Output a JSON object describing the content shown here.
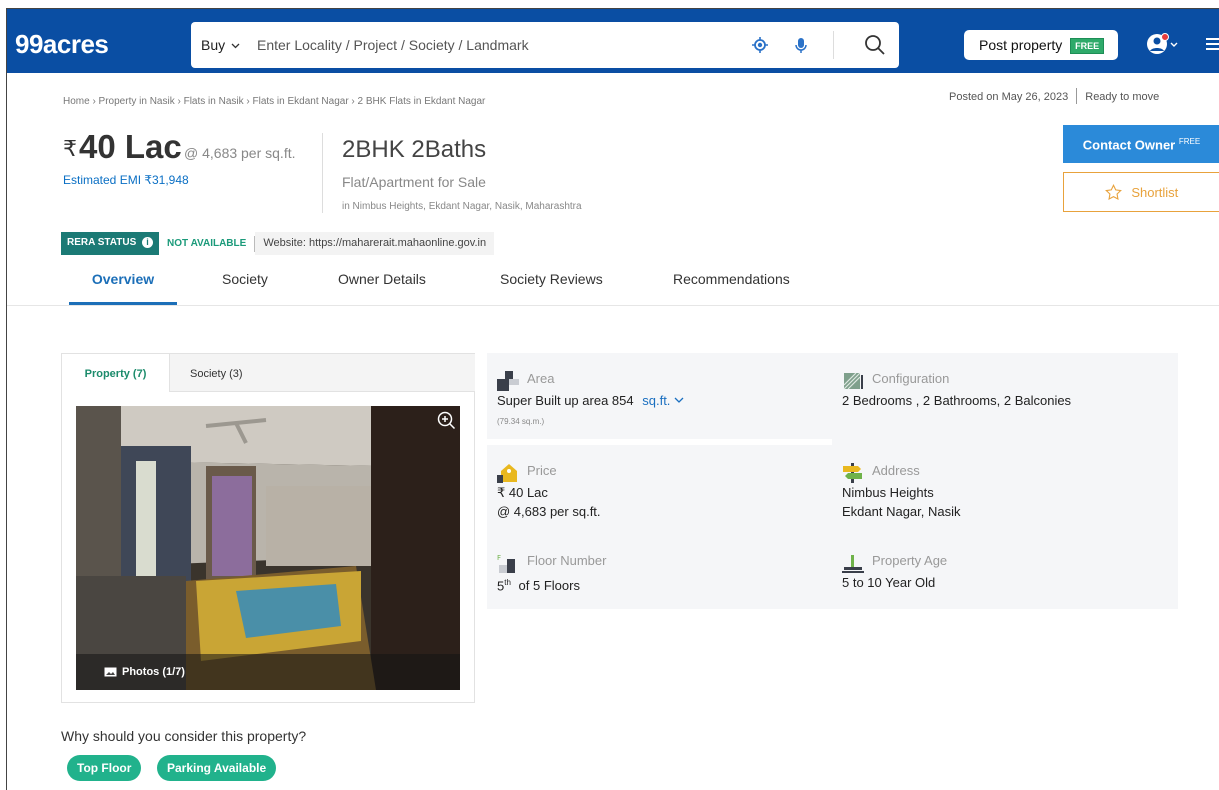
{
  "header": {
    "logo": "99acres",
    "buy_label": "Buy",
    "search_placeholder": "Enter Locality / Project / Society / Landmark",
    "post_label": "Post property",
    "post_badge": "FREE"
  },
  "breadcrumb": "Home › Property in Nasik › Flats in Nasik › Flats in Ekdant Nagar › 2 BHK Flats in Ekdant Nagar",
  "posted": {
    "date": "Posted on May 26, 2023",
    "status": "Ready to move"
  },
  "price": {
    "currency": "₹",
    "amount": "40 Lac",
    "per_sqft": "@ 4,683 per sq.ft.",
    "emi": "Estimated EMI ₹31,948"
  },
  "listing": {
    "title": "2BHK 2Baths",
    "type": "Flat/Apartment for Sale",
    "location": "in Nimbus Heights, Ekdant Nagar, Nasik, Maharashtra"
  },
  "actions": {
    "contact": "Contact Owner",
    "contact_sup": "FREE",
    "shortlist": "Shortlist"
  },
  "rera": {
    "badge": "RERA STATUS",
    "info": "i",
    "status": "NOT AVAILABLE",
    "website": "Website: https://maharerait.mahaonline.gov.in"
  },
  "tabs": [
    "Overview",
    "Society",
    "Owner Details",
    "Society Reviews",
    "Recommendations"
  ],
  "photo_panel": {
    "tab_property": "Property (7)",
    "tab_society": "Society (3)",
    "photos_label": "Photos (1/7)"
  },
  "details": {
    "area": {
      "label": "Area",
      "value": "Super Built up area 854",
      "unit": "sq.ft.",
      "sub": "(79.34 sq.m.)"
    },
    "configuration": {
      "label": "Configuration",
      "value": "2 Bedrooms , 2 Bathrooms, 2 Balconies"
    },
    "price": {
      "label": "Price",
      "line1": "₹ 40 Lac",
      "line2": "@ 4,683 per sq.ft."
    },
    "address": {
      "label": "Address",
      "line1": "Nimbus Heights",
      "line2": "Ekdant Nagar, Nasik"
    },
    "floor": {
      "label": "Floor Number",
      "floor": "5",
      "suffix": "th",
      "rest": "of 5 Floors"
    },
    "age": {
      "label": "Property Age",
      "value": "5 to 10 Year Old"
    }
  },
  "why": {
    "title": "Why should you consider this property?",
    "chips": [
      "Top Floor",
      "Parking Available"
    ]
  },
  "colors": {
    "header_bg": "#0a4ea3",
    "accent_blue": "#1c6fb8",
    "contact_btn": "#2b8ad9",
    "shortlist_border": "#e8a23c",
    "chip_green": "#21b28c",
    "rera_teal": "#1b7a75"
  }
}
